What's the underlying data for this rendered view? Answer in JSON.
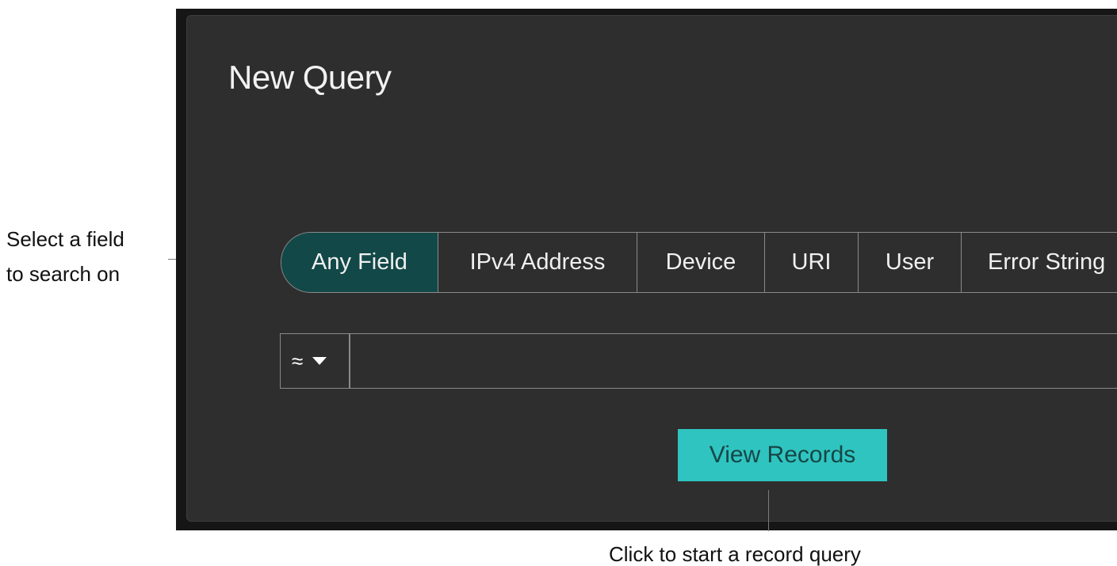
{
  "dialog": {
    "title": "New Query",
    "field_tabs": [
      {
        "label": "Any Field",
        "active": true
      },
      {
        "label": "IPv4 Address",
        "active": false
      },
      {
        "label": "Device",
        "active": false
      },
      {
        "label": "URI",
        "active": false
      },
      {
        "label": "User",
        "active": false
      },
      {
        "label": "Error String",
        "active": false
      }
    ],
    "operator_symbol": "≈",
    "query_value": "",
    "view_records_label": "View Records"
  },
  "annotations": {
    "field_select_line1": "Select a field",
    "field_select_line2": "to search on",
    "view_records_hint": "Click to start a record query"
  },
  "colors": {
    "panel_bg": "#2e2e2e",
    "active_tab_bg": "#124848",
    "button_bg": "#2fc4c0"
  }
}
